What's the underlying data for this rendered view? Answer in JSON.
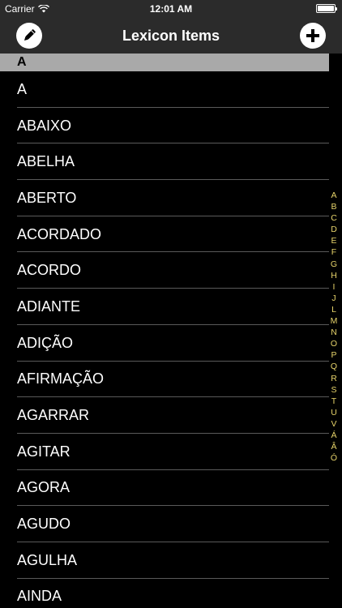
{
  "status_bar": {
    "carrier": "Carrier",
    "time": "12:01 AM"
  },
  "nav": {
    "title": "Lexicon Items",
    "left_icon": "pencil-icon",
    "right_icon": "plus-icon"
  },
  "section": {
    "header": "A"
  },
  "items": [
    "A",
    "ABAIXO",
    "ABELHA",
    "ABERTO",
    "ACORDADO",
    "ACORDO",
    "ADIANTE",
    "ADIÇÃO",
    "AFIRMAÇÃO",
    "AGARRAR",
    "AGITAR",
    "AGORA",
    "AGUDO",
    "AGULHA",
    "AINDA"
  ],
  "index": [
    "A",
    "B",
    "C",
    "D",
    "E",
    "F",
    "G",
    "H",
    "I",
    "J",
    "L",
    "M",
    "N",
    "O",
    "P",
    "Q",
    "R",
    "S",
    "T",
    "U",
    "V",
    "Á",
    "Â",
    "Ó"
  ],
  "colors": {
    "bar": "#2b2b2b",
    "section_header": "#a9a9a9",
    "index_letter": "#e6d36a",
    "separator": "#5a5a5a"
  }
}
